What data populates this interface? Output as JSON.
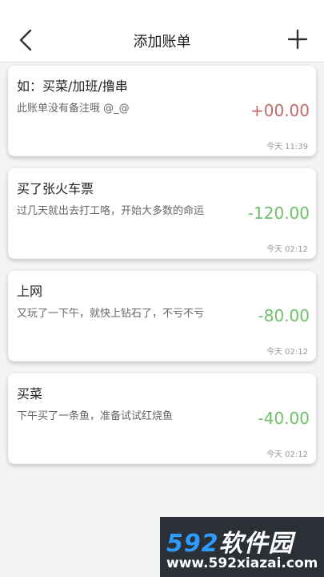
{
  "header": {
    "title": "添加账单"
  },
  "bills": [
    {
      "title": "如：买菜/加班/撸串",
      "note": "此账单没有备注哦 @_@",
      "amount": "+00.00",
      "time": "今天 11:39",
      "type": "income"
    },
    {
      "title": "买了张火车票",
      "note": "过几天就出去打工咯，开始大多数的命运",
      "amount": "-120.00",
      "time": "今天 02:12",
      "type": "expense"
    },
    {
      "title": "上网",
      "note": "又玩了一下午，就快上钻石了，不亏不亏",
      "amount": "-80.00",
      "time": "今天 02:12",
      "type": "expense"
    },
    {
      "title": "买菜",
      "note": "下午买了一条鱼，准备试试红烧鱼",
      "amount": "-40.00",
      "time": "今天 02:12",
      "type": "expense"
    }
  ],
  "colors": {
    "income": "#c06a6a",
    "expense": "#6fbf6a"
  },
  "watermark": {
    "num": "592",
    "brand": "软件园",
    "url": "www.592xiazai.com"
  }
}
